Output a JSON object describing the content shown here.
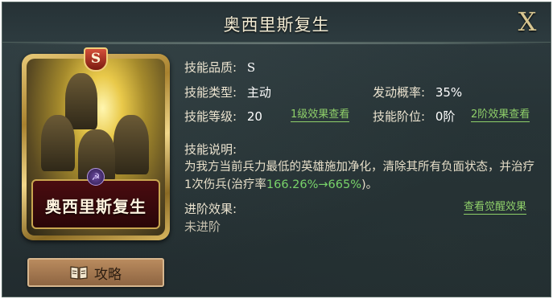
{
  "dialog": {
    "title": "奥西里斯复生",
    "close_label": "X"
  },
  "card": {
    "grade_badge": "S",
    "name": "奥西里斯复生",
    "emblem_icon": "hammer-sickle-icon"
  },
  "strategy_button": {
    "label": "攻略",
    "icon": "book-icon"
  },
  "skill": {
    "quality_label": "技能品质:",
    "quality_value": "S",
    "type_label": "技能类型:",
    "type_value": "主动",
    "chance_label": "发动概率:",
    "chance_value": "35%",
    "level_label": "技能等级:",
    "level_value": "20",
    "level1_link": "1级效果查看",
    "tier_label": "技能阶位:",
    "tier_value": "0阶",
    "tier2_link": "2阶效果查看"
  },
  "description": {
    "label": "技能说明:",
    "text_part1": "为我方当前兵力最低的英雄施加净化，清除其所有负面状态，并治疗1次伤兵(治疗率",
    "text_highlight": "166.26%→665%",
    "text_part2": ")。"
  },
  "advancement": {
    "label": "进阶效果:",
    "link": "查看觉醒效果",
    "value": "未进阶"
  },
  "colors": {
    "panel_bg": "#273336",
    "accent_gold": "#d8c690",
    "link_green": "#8fd06a",
    "highlight_green": "#79d46a",
    "button_brown": "#a87a50"
  }
}
